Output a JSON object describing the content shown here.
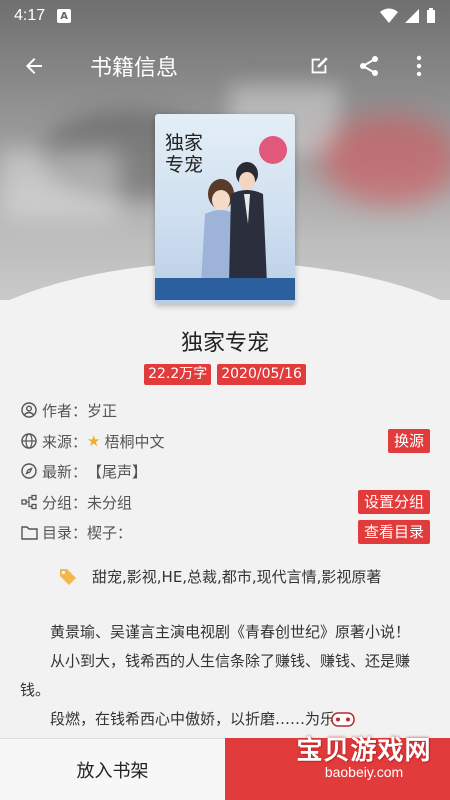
{
  "status": {
    "time": "4:17",
    "notif_glyph": "A"
  },
  "appbar": {
    "title": "书籍信息"
  },
  "icons": {
    "back": "arrow-left-icon",
    "edit": "edit-icon",
    "share": "share-icon",
    "more": "more-vert-icon"
  },
  "book": {
    "title": "独家专宠",
    "cover_title": "独家专宠",
    "tags": [
      "22.2万字",
      "2020/05/16"
    ],
    "author_label": "作者：",
    "author": "岁正",
    "source_label": "来源：",
    "source": "梧桐中文",
    "source_button": "换源",
    "latest_label": "最新：",
    "latest": "【尾声】",
    "group_label": "分组：",
    "group": "未分组",
    "group_button": "设置分组",
    "toc_label": "目录：",
    "toc": "楔子：",
    "toc_button": "查看目录",
    "keywords": "甜宠,影视,HE,总裁,都市,现代言情,影视原著",
    "description": [
      "黄景瑜、吴谨言主演电视剧《青春创世纪》原著小说！",
      "从小到大，钱希西的人生信条除了赚钱、赚钱、还是赚钱。",
      "段燃，在钱希西心中傲娇，以折磨……为乐"
    ]
  },
  "bottom": {
    "add_to_shelf": "放入书架"
  },
  "watermark": {
    "text": "宝贝游戏网",
    "url": "baobeiy.com"
  },
  "colors": {
    "accent": "#e23b3b",
    "background": "#f2f2f2"
  }
}
